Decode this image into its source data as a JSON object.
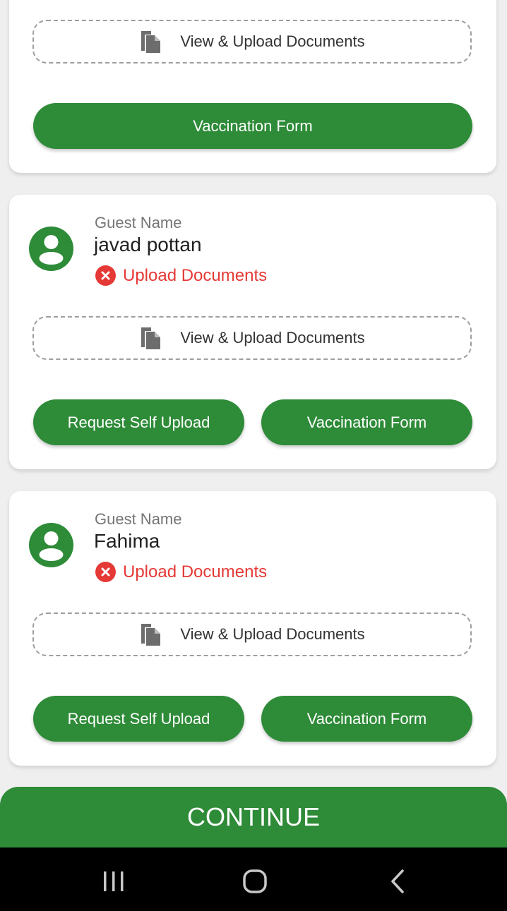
{
  "colors": {
    "brand_green": "#2e8b38",
    "error_red": "#e53935",
    "card_bg": "#ffffff",
    "page_bg": "#efefef",
    "nav_bg": "#000000"
  },
  "cards": [
    {
      "upload_box": {
        "icon": "documents-icon",
        "label": "View & Upload Documents"
      },
      "buttons": [
        {
          "label": "Vaccination Form"
        }
      ]
    },
    {
      "guest_label": "Guest Name",
      "guest_name": "javad pottan",
      "status": {
        "icon": "error-circle-icon",
        "text": "Upload Documents"
      },
      "upload_box": {
        "icon": "documents-icon",
        "label": "View & Upload Documents"
      },
      "buttons": [
        {
          "label": "Request Self Upload"
        },
        {
          "label": "Vaccination Form"
        }
      ]
    },
    {
      "guest_label": "Guest Name",
      "guest_name": "Fahima",
      "status": {
        "icon": "error-circle-icon",
        "text": "Upload Documents"
      },
      "upload_box": {
        "icon": "documents-icon",
        "label": "View & Upload Documents"
      },
      "buttons": [
        {
          "label": "Request Self Upload"
        },
        {
          "label": "Vaccination Form"
        }
      ]
    }
  ],
  "continue_button": {
    "label": "CONTINUE"
  },
  "nav_bar": {
    "icons": [
      "recent-apps-icon",
      "home-icon",
      "back-icon"
    ]
  }
}
